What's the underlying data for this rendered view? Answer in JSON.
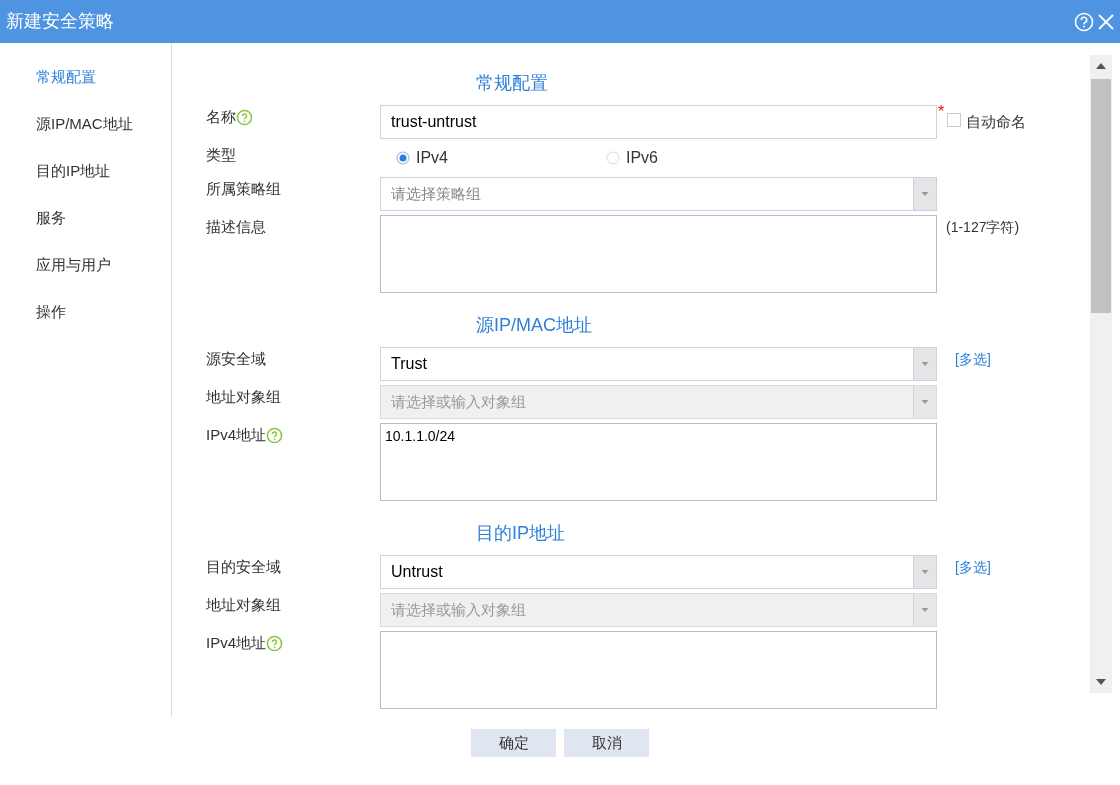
{
  "window": {
    "title": "新建安全策略"
  },
  "sidebar": {
    "items": [
      {
        "label": "常规配置",
        "selected": true
      },
      {
        "label": "源IP/MAC地址",
        "selected": false
      },
      {
        "label": "目的IP地址",
        "selected": false
      },
      {
        "label": "服务",
        "selected": false
      },
      {
        "label": "应用与用户",
        "selected": false
      },
      {
        "label": "操作",
        "selected": false
      }
    ]
  },
  "sections": [
    {
      "title": "常规配置",
      "rows": [
        {
          "kind": "text",
          "label": "名称",
          "help": true,
          "value": "trust-untrust",
          "required_mark": "*",
          "checkbox": {
            "label": "自动命名",
            "checked": false
          }
        },
        {
          "kind": "radio",
          "label": "类型",
          "options": [
            {
              "label": "IPv4",
              "selected": true
            },
            {
              "label": "IPv6",
              "selected": false
            }
          ]
        },
        {
          "kind": "select",
          "label": "所属策略组",
          "placeholder": "请选择策略组",
          "disabled": false
        },
        {
          "kind": "textarea",
          "label": "描述信息",
          "hint": "(1-127字符)"
        }
      ]
    },
    {
      "title": "源IP/MAC地址",
      "rows": [
        {
          "kind": "select",
          "label": "源安全域",
          "value": "Trust",
          "disabled": false,
          "link": "[多选]"
        },
        {
          "kind": "select",
          "label": "地址对象组",
          "placeholder": "请选择或输入对象组",
          "disabled": true
        },
        {
          "kind": "textarea",
          "label": "IPv4地址",
          "help": true,
          "value": "10.1.1.0/24"
        }
      ]
    },
    {
      "title": "目的IP地址",
      "rows": [
        {
          "kind": "select",
          "label": "目的安全域",
          "value": "Untrust",
          "disabled": false,
          "link": "[多选]"
        },
        {
          "kind": "select",
          "label": "地址对象组",
          "placeholder": "请选择或输入对象组",
          "disabled": true
        },
        {
          "kind": "textarea",
          "label": "IPv4地址",
          "help": true
        }
      ]
    }
  ],
  "buttons": [
    "确定",
    "取消"
  ]
}
